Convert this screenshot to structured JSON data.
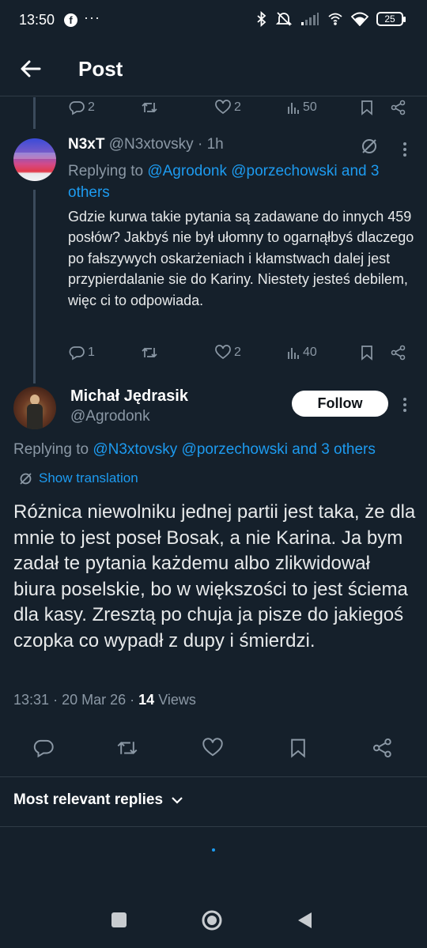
{
  "status": {
    "time": "13:50",
    "fb_badge": "f",
    "more": "···",
    "battery": "25"
  },
  "header": {
    "title": "Post"
  },
  "prev_tweet_stats": {
    "replies": "2",
    "retweets": "",
    "likes": "2",
    "views": "50"
  },
  "reply_tweet": {
    "name": "N3xT",
    "handle": "@N3xtovsky",
    "time": "1h",
    "replying_prefix": "Replying to ",
    "replying_users": "@Agrodonk @porzechowski and 3 others",
    "body": "Gdzie kurwa takie pytania są zadawane do innych 459 posłów? Jakbyś nie był ułomny to ogarnąłbyś dlaczego po fałszywych oskarżeniach i kłamstwach dalej jest przypierdalanie sie do Kariny. Niestety jesteś debilem, więc ci to odpowiada.",
    "stats": {
      "replies": "1",
      "retweets": "",
      "likes": "2",
      "views": "40"
    }
  },
  "main_tweet": {
    "name": "Michał Jędrasik",
    "handle": "@Agrodonk",
    "follow_label": "Follow",
    "replying_prefix": "Replying to ",
    "replying_users": "@N3xtovsky @porzechowski and 3 others",
    "show_translation": "Show translation",
    "text": "Różnica niewolniku jednej partii jest taka, że dla mnie to jest poseł Bosak, a nie Karina. Ja bym zadał te pytania każdemu albo zlikwidował  biura poselskie, bo w większości to jest  ściema dla kasy. Zresztą po chuja ja pisze do jakiegoś czopka co wypadł z dupy i śmierdzi.",
    "time": "13:31",
    "date": "20 Mar 26",
    "views_count": "14",
    "views_label": "Views"
  },
  "replies_sort": {
    "label": "Most relevant replies"
  },
  "colors": {
    "background": "#15202b",
    "accent": "#1d9bf0",
    "muted": "#8b98a5",
    "text": "#e7e9ea"
  },
  "icons": [
    "back-arrow-icon",
    "reply-icon",
    "retweet-icon",
    "like-icon",
    "views-icon",
    "bookmark-icon",
    "share-icon",
    "grok-icon",
    "translate-icon",
    "chevron-down-icon"
  ]
}
